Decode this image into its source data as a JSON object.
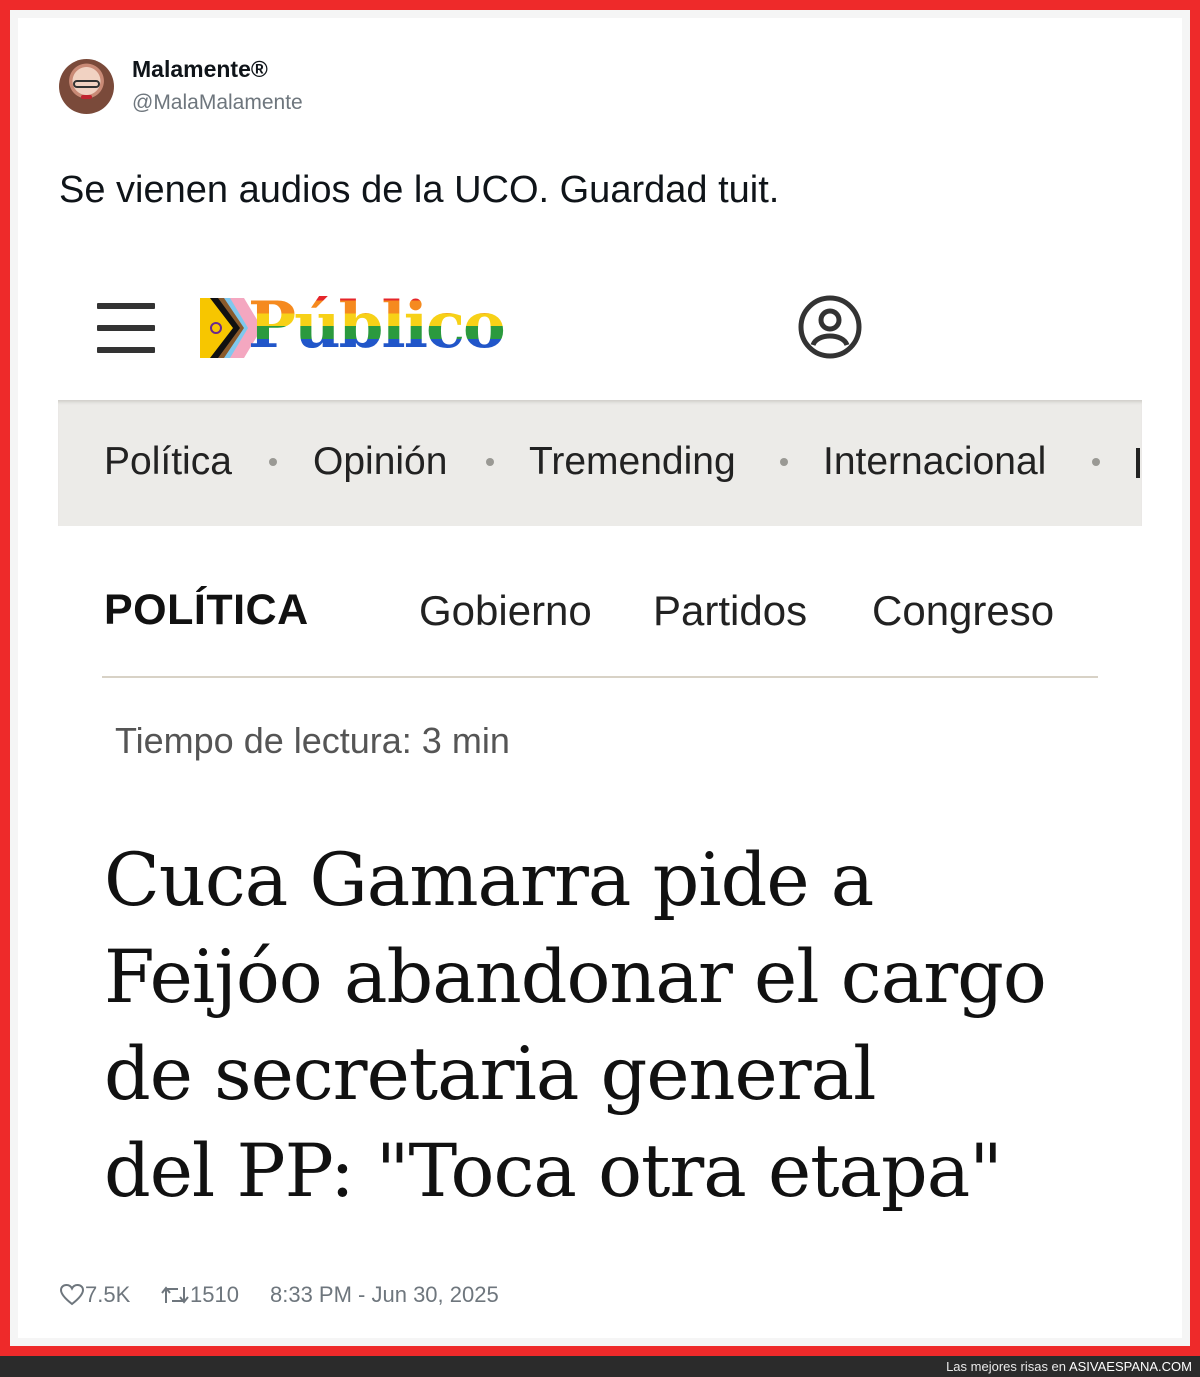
{
  "tweet": {
    "author_name": "Malamente®",
    "author_handle": "@MalaMalamente",
    "text": "Se vienen audios de la UCO. Guardad tuit.",
    "likes": "7.5K",
    "retweets": "1510",
    "timestamp": "8:33 PM - Jun 30, 2025"
  },
  "embedded_page": {
    "logo_text": "Público",
    "nav_items": [
      "Política",
      "Opinión",
      "Tremending",
      "Internacional"
    ],
    "section": "POLÍTICA",
    "subnav": [
      "Gobierno",
      "Partidos",
      "Congreso"
    ],
    "read_time": "Tiempo de lectura: 3 min",
    "headline_lines": [
      "Cuca Gamarra pide a",
      "Feijóo abandonar el cargo",
      "de secretaria general",
      "del PP: \"Toca otra etapa\""
    ]
  },
  "watermark": {
    "prefix": "Las mejores risas en",
    "brand": "ASIVAESPANA.COM"
  },
  "colors": {
    "frame": "#ee2a2a",
    "nav_background": "#ecebe8",
    "footer_bar": "#2b2b2b"
  }
}
